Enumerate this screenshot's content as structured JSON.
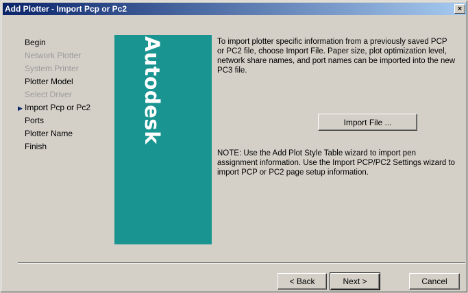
{
  "window": {
    "title": "Add Plotter - Import Pcp or Pc2",
    "close_glyph": "×"
  },
  "steps": [
    {
      "label": "Begin",
      "state": "normal"
    },
    {
      "label": "Network Plotter",
      "state": "disabled"
    },
    {
      "label": "System Printer",
      "state": "disabled"
    },
    {
      "label": "Plotter Model",
      "state": "normal"
    },
    {
      "label": "Select Driver",
      "state": "disabled"
    },
    {
      "label": "Import Pcp or Pc2",
      "state": "current"
    },
    {
      "label": "Ports",
      "state": "normal"
    },
    {
      "label": "Plotter Name",
      "state": "normal"
    },
    {
      "label": "Finish",
      "state": "normal"
    }
  ],
  "brand": {
    "text": "Autodesk",
    "color": "#1a9490"
  },
  "content": {
    "description": "To import plotter specific information from a previously saved PCP or PC2 file, choose Import File. Paper size, plot optimization level, network share names, and port names can be imported into the new PC3 file.",
    "import_button": "Import File ...",
    "note": "NOTE: Use the Add Plot Style Table wizard to import pen assignment information. Use the Import PCP/PC2 Settings wizard to import PCP or PC2 page setup information."
  },
  "footer": {
    "back": "< Back",
    "next": "Next >",
    "cancel": "Cancel"
  },
  "colors": {
    "titlebar_start": "#0a246a",
    "titlebar_end": "#a6caf0",
    "face": "#d4d0c8"
  }
}
